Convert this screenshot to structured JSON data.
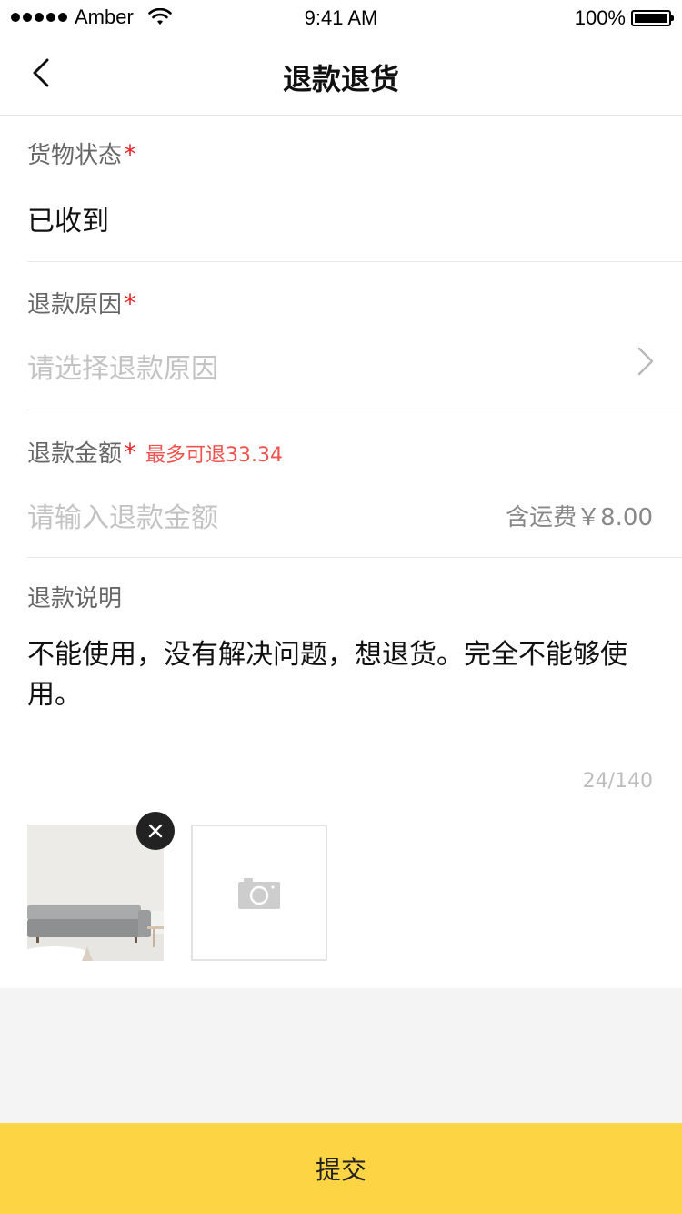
{
  "status_bar": {
    "carrier": "Amber",
    "time": "9:41 AM",
    "battery": "100%"
  },
  "nav": {
    "title": "退款退货",
    "back_icon": "chevron-left-icon"
  },
  "goods_status": {
    "label": "货物状态",
    "required_mark": "*",
    "value": "已收到"
  },
  "reason": {
    "label": "退款原因",
    "required_mark": "*",
    "placeholder": "请选择退款原因",
    "icon": "chevron-right-icon"
  },
  "amount": {
    "label": "退款金额",
    "required_mark": "*",
    "max_hint": "最多可退33.34",
    "placeholder": "请输入退款金额",
    "freight_note": "含运费￥8.00"
  },
  "explanation": {
    "label": "退款说明",
    "text": "不能使用，没有解决问题，想退货。完全不能够使用。",
    "counter": "24/140"
  },
  "photos": {
    "remove_icon": "close-icon",
    "add_icon": "camera-icon"
  },
  "submit": {
    "label": "提交"
  },
  "colors": {
    "accent": "#fdd444",
    "required": "#e8242a",
    "hint": "#f0524f",
    "background_gray": "#f4f4f4"
  }
}
